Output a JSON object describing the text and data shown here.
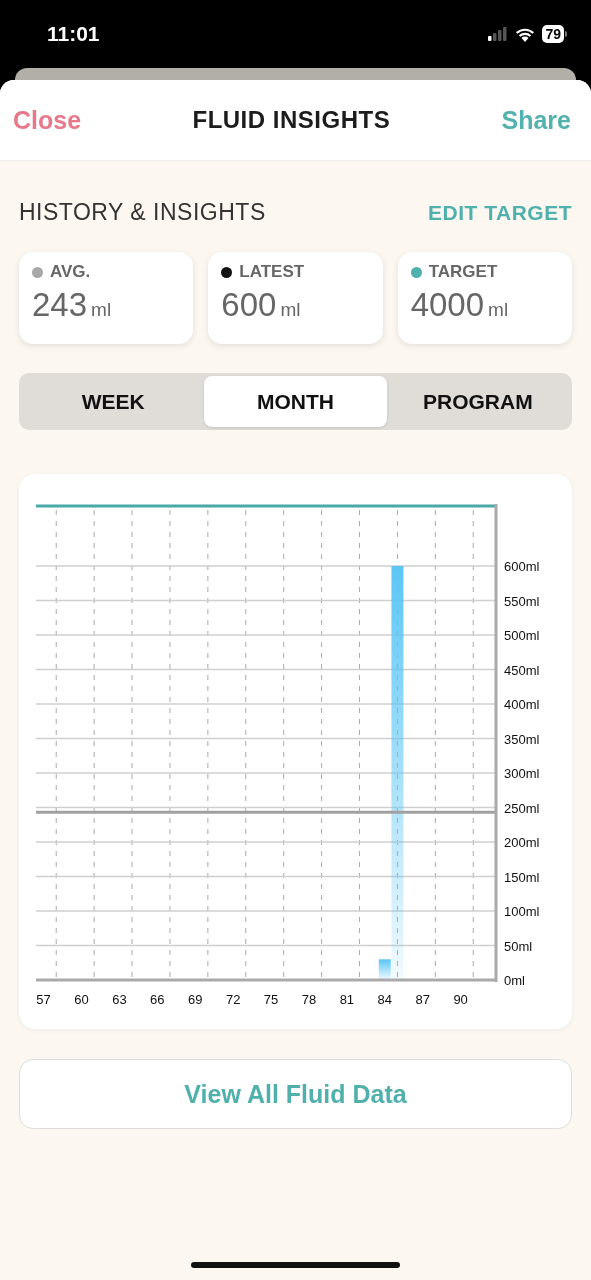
{
  "status_bar": {
    "time": "11:01",
    "battery": "79"
  },
  "header": {
    "close": "Close",
    "title": "FLUID INSIGHTS",
    "share": "Share"
  },
  "section": {
    "title": "HISTORY & INSIGHTS",
    "action": "EDIT TARGET"
  },
  "stats": [
    {
      "label": "AVG.",
      "value": "243",
      "unit": "ml",
      "color": "#a8a8a8"
    },
    {
      "label": "LATEST",
      "value": "600",
      "unit": "ml",
      "color": "#111111"
    },
    {
      "label": "TARGET",
      "value": "4000",
      "unit": "ml",
      "color": "#4fb0ac"
    }
  ],
  "tabs": [
    {
      "label": "WEEK",
      "selected": false
    },
    {
      "label": "MONTH",
      "selected": true
    },
    {
      "label": "PROGRAM",
      "selected": false
    }
  ],
  "chart": {
    "chart_data": {
      "type": "bar",
      "x": [
        84,
        85
      ],
      "series": [
        {
          "color": "#5bc6f5",
          "values": [
            30,
            600
          ]
        }
      ],
      "grid": true,
      "xlim": [
        56.4,
        92.8
      ],
      "ylim": [
        0,
        687
      ],
      "xticks": [
        57,
        60,
        63,
        66,
        69,
        72,
        75,
        78,
        81,
        84,
        87,
        90
      ],
      "yticks": [
        {
          "value": 0,
          "label": "0ml"
        },
        {
          "value": 50,
          "label": "50ml"
        },
        {
          "value": 100,
          "label": "100ml"
        },
        {
          "value": 150,
          "label": "150ml"
        },
        {
          "value": 200,
          "label": "200ml"
        },
        {
          "value": 250,
          "label": "250ml"
        },
        {
          "value": 300,
          "label": "300ml"
        },
        {
          "value": 350,
          "label": "350ml"
        },
        {
          "value": 400,
          "label": "400ml"
        },
        {
          "value": 450,
          "label": "450ml"
        },
        {
          "value": 500,
          "label": "500ml"
        },
        {
          "value": 550,
          "label": "550ml"
        },
        {
          "value": 600,
          "label": "600ml"
        }
      ],
      "ref_lines": [
        {
          "axis": "y",
          "value": 243
        }
      ]
    }
  },
  "view_all_button": "View All Fluid Data"
}
